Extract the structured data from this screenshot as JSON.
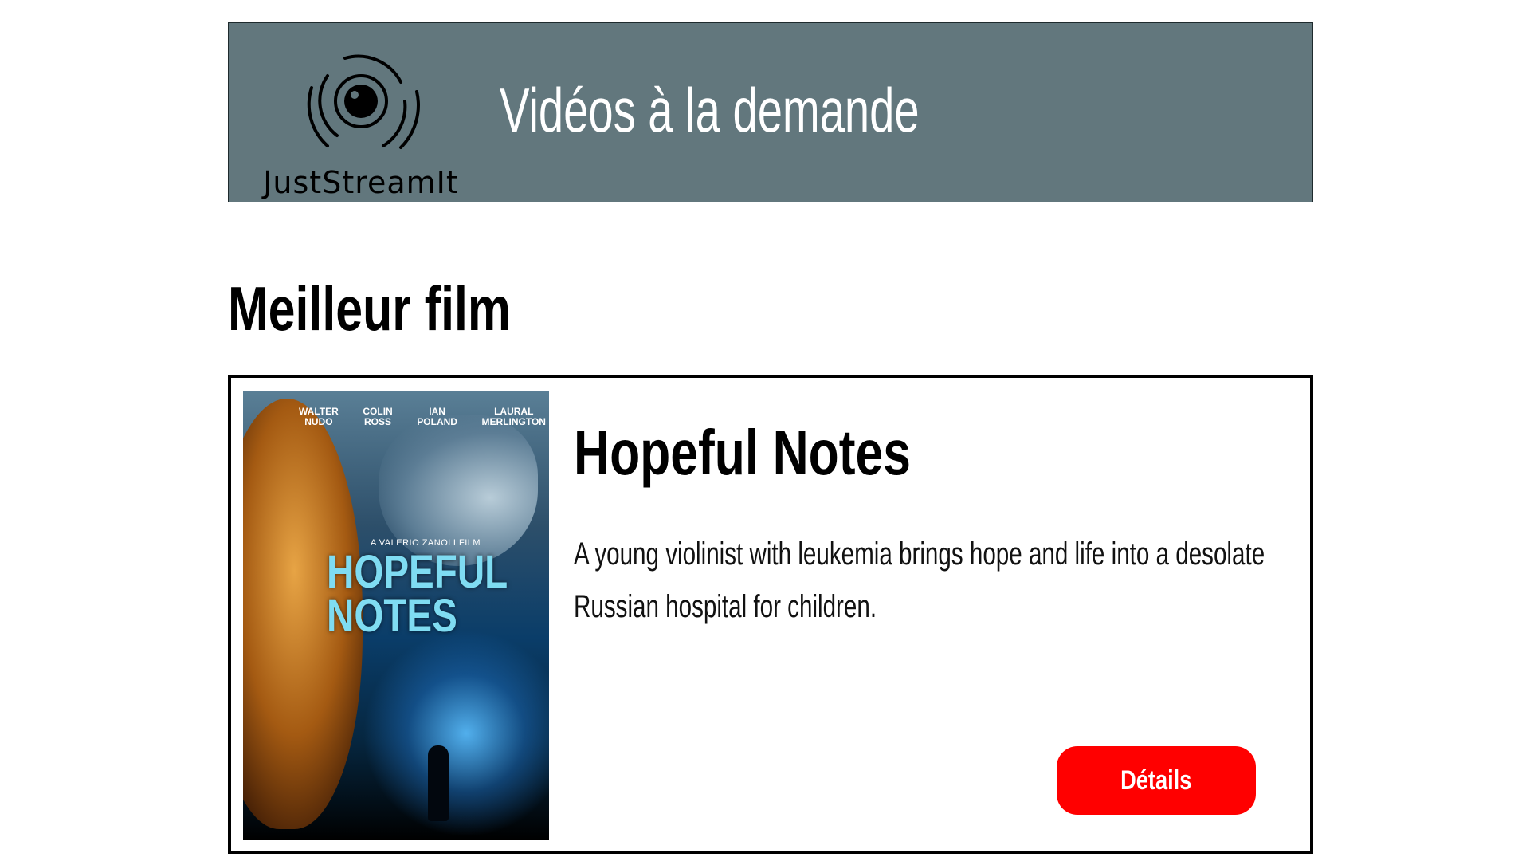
{
  "header": {
    "logo_text": "JustStreamIt",
    "title": "Vidéos à la demande"
  },
  "best_movie": {
    "section_title": "Meilleur film",
    "title": "Hopeful Notes",
    "description": "A young violinist with leukemia brings hope and life into a desolate Russian hospital for children.",
    "details_label": "Détails",
    "poster": {
      "cast": [
        "WALTER\nNUDO",
        "COLIN\nROSS",
        "IAN\nPOLAND",
        "LAURAL\nMERLINGTON"
      ],
      "director_line": "A VALERIO ZANOLI FILM",
      "title": "HOPEFUL\nNOTES"
    }
  },
  "colors": {
    "header_bg": "#62777d",
    "button_bg": "#ff0000"
  }
}
